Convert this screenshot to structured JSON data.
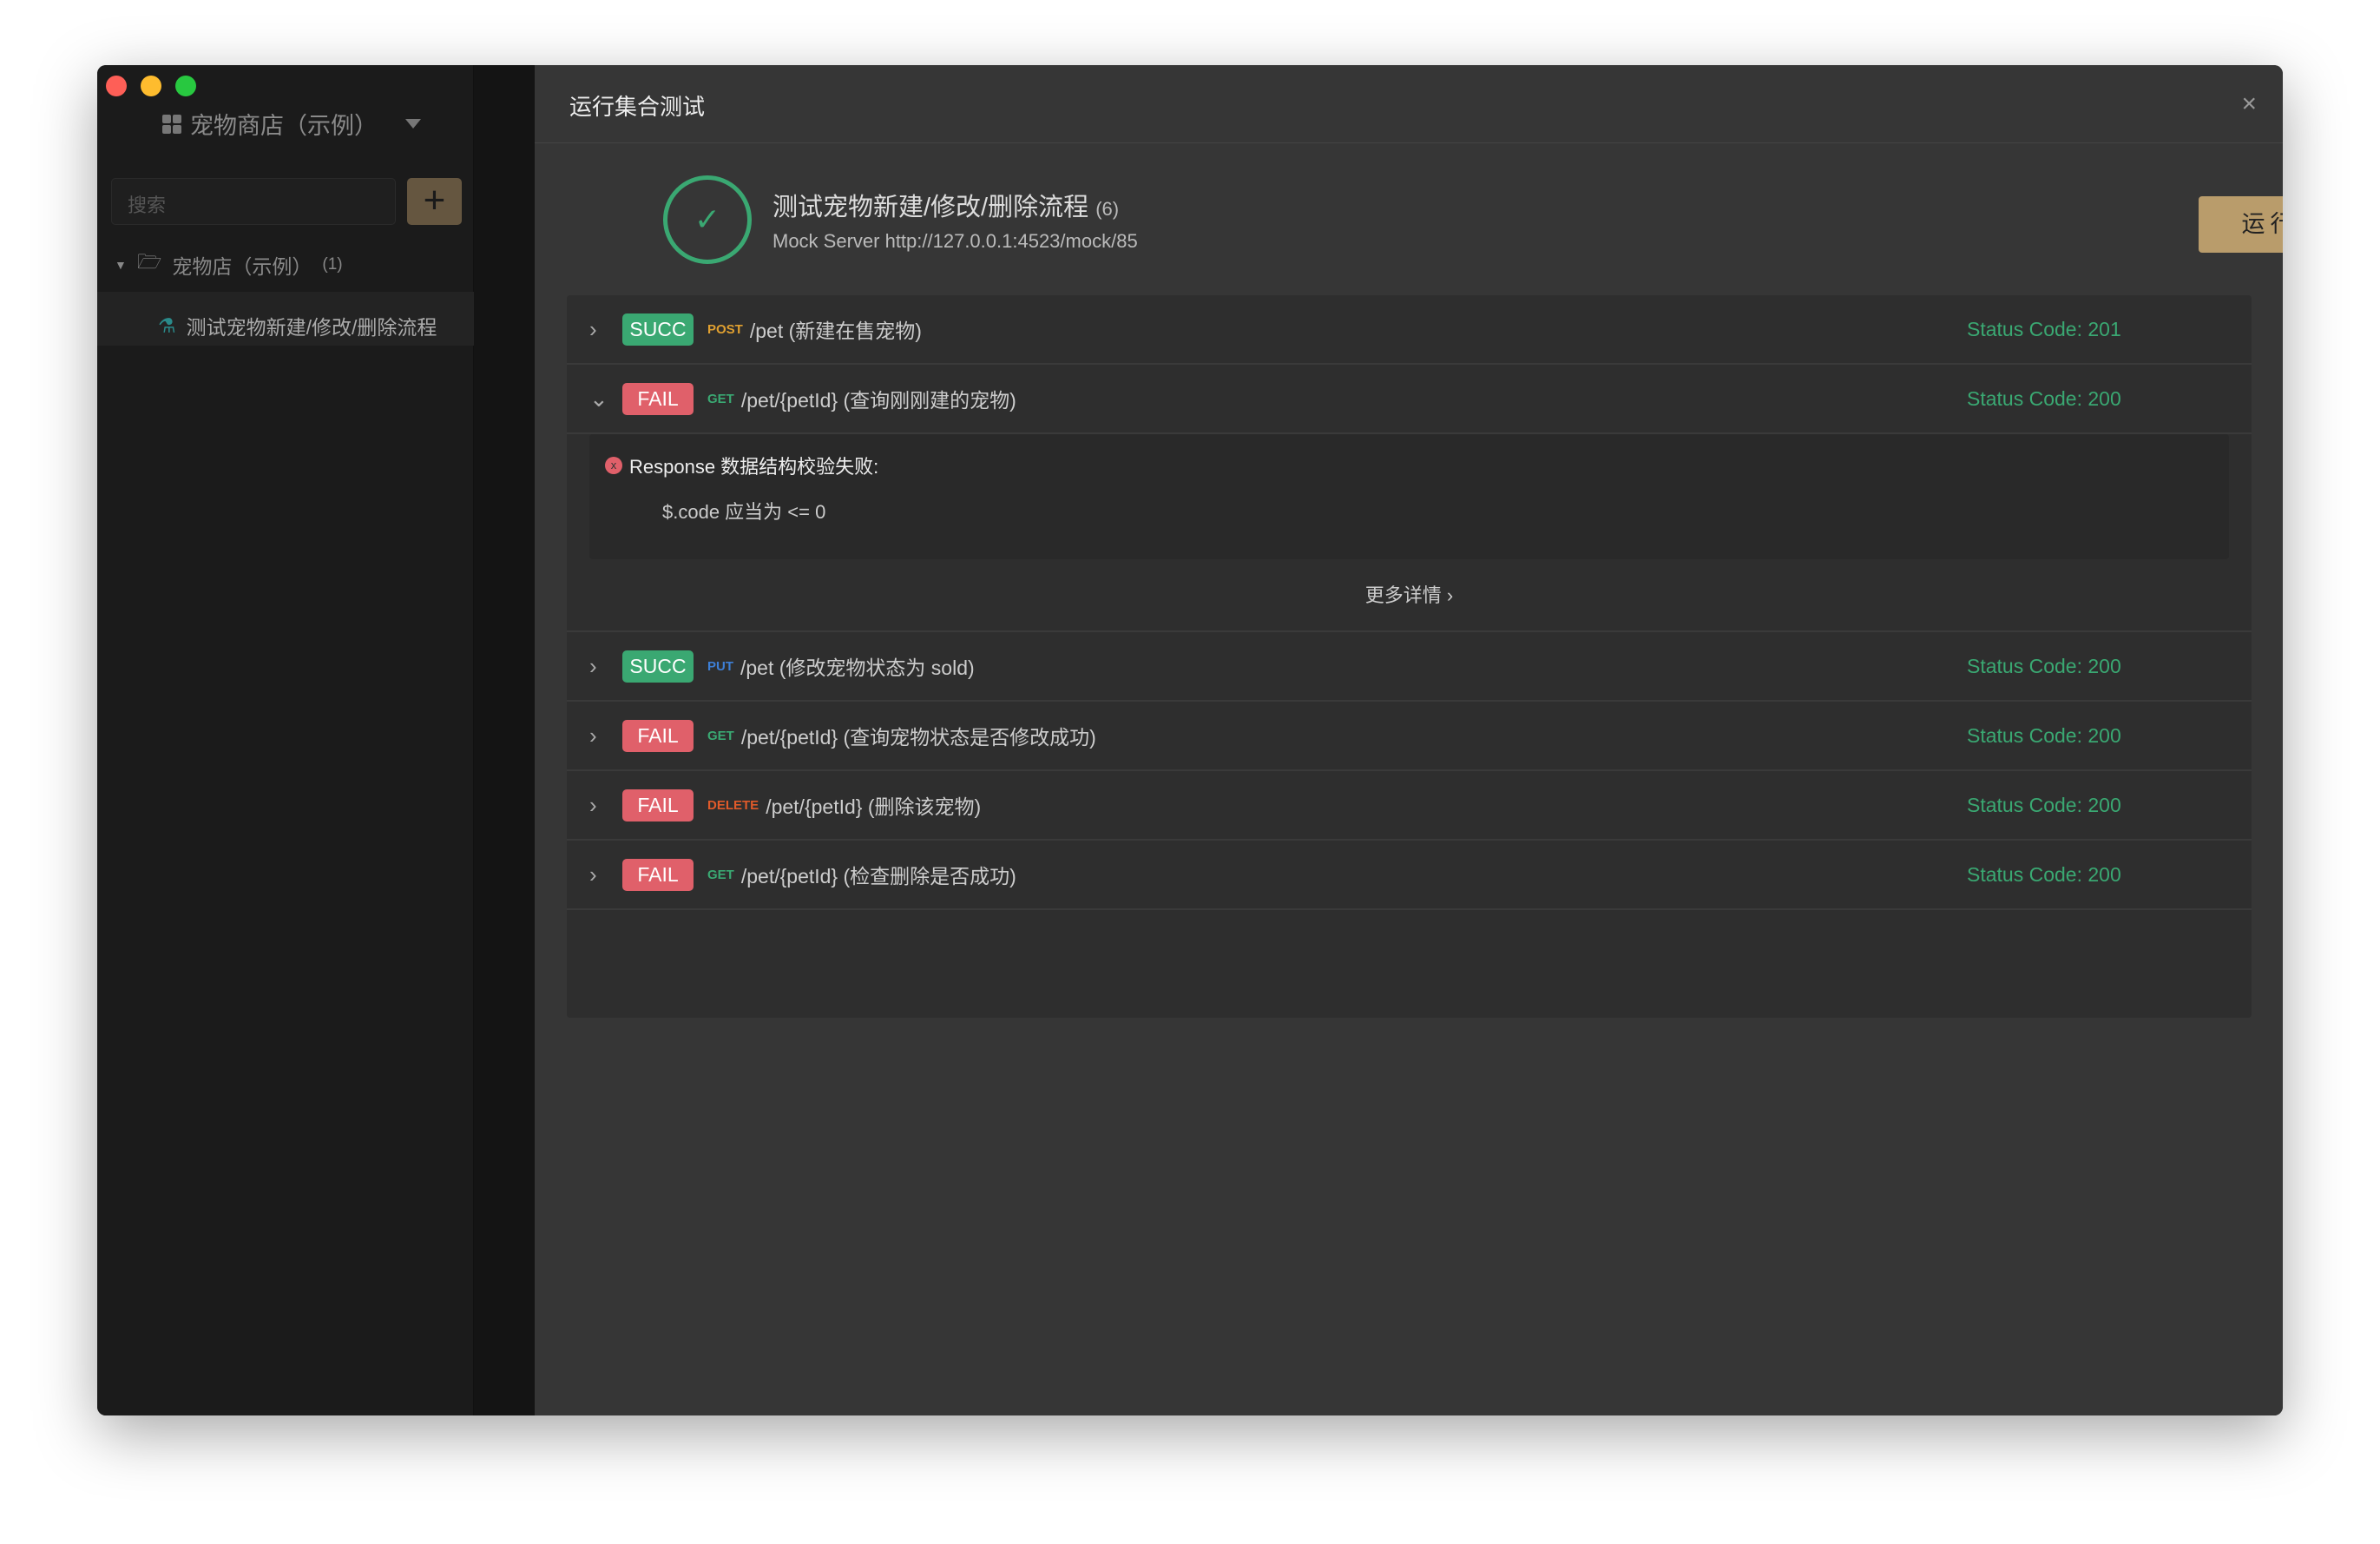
{
  "sidebar": {
    "project": "宠物商店（示例）",
    "search_placeholder": "搜索",
    "plus": "+",
    "folder": "宠物店（示例）",
    "folder_count": "(1)",
    "item": "测试宠物新建/修改/删除流程"
  },
  "modal": {
    "title": "运行集合测试",
    "close": "×",
    "suite_title": "测试宠物新建/修改/删除流程",
    "suite_count": "(6)",
    "mock": "Mock Server http://127.0.0.1:4523/mock/85",
    "run": "运行",
    "check": "✓",
    "rows": [
      {
        "status": "SUCC",
        "method": "POST",
        "method_color": "#e0a030",
        "path": "/pet (新建在售宠物)",
        "code": "Status Code: 201"
      },
      {
        "status": "FAIL",
        "method": "GET",
        "method_color": "#3aa872",
        "path": "/pet/{petId} (查询刚刚建的宠物)",
        "code": "Status Code: 200"
      },
      {
        "status": "SUCC",
        "method": "PUT",
        "method_color": "#3d7fd6",
        "path": "/pet (修改宠物状态为 sold)",
        "code": "Status Code: 200"
      },
      {
        "status": "FAIL",
        "method": "GET",
        "method_color": "#3aa872",
        "path": "/pet/{petId} (查询宠物状态是否修改成功)",
        "code": "Status Code: 200"
      },
      {
        "status": "FAIL",
        "method": "DELETE",
        "method_color": "#e05a2a",
        "path": "/pet/{petId} (删除该宠物)",
        "code": "Status Code: 200"
      },
      {
        "status": "FAIL",
        "method": "GET",
        "method_color": "#3aa872",
        "path": "/pet/{petId} (检查删除是否成功)",
        "code": "Status Code: 200"
      }
    ],
    "error": {
      "title": "Response 数据结构校验失败:",
      "detail": "$.code 应当为 <= 0",
      "more": "更多详情 ›"
    }
  }
}
